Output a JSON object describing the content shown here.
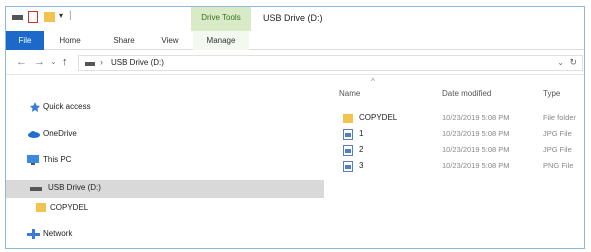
{
  "window": {
    "title": "USB Drive (D:)",
    "context_tab_group": "Drive Tools"
  },
  "quick_access_toolbar": {
    "dropdown_glyph": "▾",
    "separator": "|"
  },
  "ribbon": {
    "tabs": [
      "File",
      "Home",
      "Share",
      "View",
      "Manage"
    ]
  },
  "address_bar": {
    "back": "←",
    "forward": "→",
    "recent": "⌄",
    "up": "↑",
    "separator": "›",
    "path": "USB Drive (D:)",
    "dropdown": "⌄",
    "refresh": "↻"
  },
  "nav_pane": {
    "items": [
      {
        "label": "Quick access",
        "icon": "pin-icon"
      },
      {
        "label": "OneDrive",
        "icon": "cloud-icon"
      },
      {
        "label": "This PC",
        "icon": "computer-icon"
      },
      {
        "label": "USB Drive (D:)",
        "icon": "usb-drive-icon",
        "selected": true
      },
      {
        "label": "COPYDEL",
        "icon": "folder-icon"
      },
      {
        "label": "Network",
        "icon": "network-icon"
      }
    ]
  },
  "details": {
    "sort_indicator": "^",
    "columns": [
      "Name",
      "Date modified",
      "Type"
    ],
    "rows": [
      {
        "name": "COPYDEL",
        "date": "10/23/2019 5:08 PM",
        "type": "File folder",
        "icon": "folder-icon"
      },
      {
        "name": "1",
        "date": "10/23/2019 5:08 PM",
        "type": "JPG File",
        "icon": "image-file-icon"
      },
      {
        "name": "2",
        "date": "10/23/2019 5:08 PM",
        "type": "JPG File",
        "icon": "image-file-icon"
      },
      {
        "name": "3",
        "date": "10/23/2019 5:08 PM",
        "type": "PNG File",
        "icon": "image-file-icon"
      }
    ]
  },
  "colors": {
    "file_tab": "#1b6ac9",
    "context_tab": "#d8ebc6",
    "selection": "#d9d9d9",
    "folder": "#f2c44f"
  }
}
